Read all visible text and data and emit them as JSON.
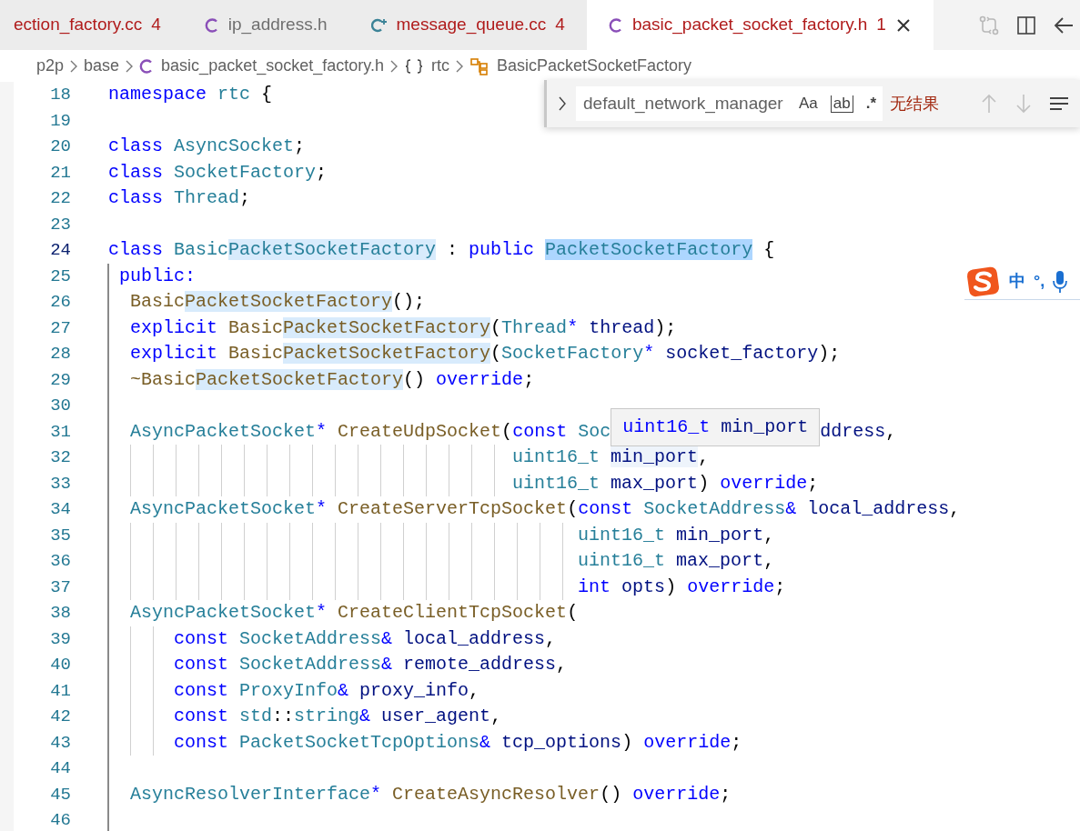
{
  "tabs": [
    {
      "label": "ection_factory.cc",
      "problems": "4",
      "kind": "plain",
      "color": "#b01b1b",
      "selected": false
    },
    {
      "label": "ip_address.h",
      "kind": "c",
      "color": "#6f6f6f",
      "selected": false
    },
    {
      "label": "message_queue.cc",
      "problems": "4",
      "kind": "cpp",
      "color": "#b01b1b",
      "selected": false
    },
    {
      "label": "basic_packet_socket_factory.h",
      "problems": "1",
      "kind": "c",
      "color": "#b01b1b",
      "selected": true
    }
  ],
  "breadcrumbs": [
    {
      "text": "p2p",
      "kind": "folder"
    },
    {
      "text": "base",
      "kind": "folder"
    },
    {
      "text": "basic_packet_socket_factory.h",
      "kind": "c"
    },
    {
      "text": "rtc",
      "kind": "namespace"
    },
    {
      "text": "BasicPacketSocketFactory",
      "kind": "class"
    }
  ],
  "find": {
    "expanded": false,
    "value": "default_network_manager",
    "toggles": [
      {
        "label": "Aa",
        "kind": "case",
        "selected": false
      },
      {
        "label": "ab",
        "kind": "word",
        "selected": false
      },
      {
        "label": ".*",
        "kind": "regex",
        "selected": false
      }
    ],
    "result": "无结果"
  },
  "ime": {
    "mode": "中",
    "punctuation": "°,"
  },
  "lines": [
    {
      "number": "18",
      "current": false,
      "in_block": false,
      "tokens": [
        {
          "text": "namespace",
          "kind": "keyword"
        },
        {
          "text": " rtc",
          "kind": "type"
        },
        {
          "text": " {",
          "kind": "punct"
        }
      ]
    },
    {
      "number": "19",
      "current": false,
      "in_block": false
    },
    {
      "number": "20",
      "current": false,
      "in_block": false,
      "tokens": [
        {
          "text": "class",
          "kind": "keyword"
        },
        {
          "text": " AsyncSocket",
          "kind": "type"
        },
        {
          "text": ";",
          "kind": "punct"
        }
      ]
    },
    {
      "number": "21",
      "current": false,
      "in_block": false,
      "tokens": [
        {
          "text": "class",
          "kind": "keyword"
        },
        {
          "text": " SocketFactory",
          "kind": "type"
        },
        {
          "text": ";",
          "kind": "punct"
        }
      ]
    },
    {
      "number": "22",
      "current": false,
      "in_block": false,
      "tokens": [
        {
          "text": "class",
          "kind": "keyword"
        },
        {
          "text": " Thread",
          "kind": "type"
        },
        {
          "text": ";",
          "kind": "punct"
        }
      ]
    },
    {
      "number": "23",
      "current": false,
      "in_block": false
    },
    {
      "number": "24",
      "current": true,
      "in_block": false,
      "tokens": [
        {
          "text": "class",
          "kind": "keyword"
        },
        {
          "text": " Basic",
          "kind": "type"
        },
        {
          "text": "PacketSocketFactory",
          "kind": "type_match"
        },
        {
          "text": " : ",
          "kind": "punct"
        },
        {
          "text": "public ",
          "kind": "keyword"
        },
        {
          "text": "PacketSocketFactory",
          "kind": "type_selected"
        },
        {
          "text": " {",
          "kind": "punct"
        }
      ]
    },
    {
      "number": "25",
      "current": false,
      "in_block": true,
      "tokens": [
        {
          "text": " public:",
          "kind": "keyword"
        }
      ]
    },
    {
      "number": "26",
      "current": false,
      "in_block": true,
      "tokens": [
        {
          "text": "  Basic",
          "kind": "func"
        },
        {
          "text": "PacketSocketFactory",
          "kind": "func_match"
        },
        {
          "text": "();",
          "kind": "punct"
        }
      ]
    },
    {
      "number": "27",
      "current": false,
      "in_block": true,
      "tokens": [
        {
          "text": "  explicit",
          "kind": "keyword"
        },
        {
          "text": " Basic",
          "kind": "func"
        },
        {
          "text": "PacketSocketFactory",
          "kind": "func_match"
        },
        {
          "text": "(",
          "kind": "punct"
        },
        {
          "text": "Thread",
          "kind": "type"
        },
        {
          "text": "*",
          "kind": "keyword"
        },
        {
          "text": " thread",
          "kind": "param"
        },
        {
          "text": ");",
          "kind": "punct"
        }
      ]
    },
    {
      "number": "28",
      "current": false,
      "in_block": true,
      "tokens": [
        {
          "text": "  explicit",
          "kind": "keyword"
        },
        {
          "text": " Basic",
          "kind": "func"
        },
        {
          "text": "PacketSocketFactory",
          "kind": "func_match"
        },
        {
          "text": "(",
          "kind": "punct"
        },
        {
          "text": "SocketFactory",
          "kind": "type"
        },
        {
          "text": "*",
          "kind": "keyword"
        },
        {
          "text": " socket_factory",
          "kind": "param"
        },
        {
          "text": ");",
          "kind": "punct"
        }
      ]
    },
    {
      "number": "29",
      "current": false,
      "in_block": true,
      "tokens": [
        {
          "text": "  ~Basic",
          "kind": "func"
        },
        {
          "text": "PacketSocketFactory",
          "kind": "func_match"
        },
        {
          "text": "()",
          "kind": "punct"
        },
        {
          "text": " override",
          "kind": "keyword"
        },
        {
          "text": ";",
          "kind": "punct"
        }
      ]
    },
    {
      "number": "30",
      "current": false,
      "in_block": true
    },
    {
      "number": "31",
      "current": false,
      "in_block": true,
      "tokens": [
        {
          "text": "  AsyncPacketSocket",
          "kind": "type"
        },
        {
          "text": "*",
          "kind": "keyword"
        },
        {
          "text": " CreateUdpSocket",
          "kind": "func"
        },
        {
          "text": "(",
          "kind": "punct"
        },
        {
          "text": "const",
          "kind": "keyword"
        },
        {
          "text": " Soc",
          "kind": "type"
        },
        {
          "kind": "tooltip",
          "parts": [
            {
              "text": "uint16_t",
              "kind": "keyword"
            },
            {
              "text": " min_port",
              "kind": "param"
            }
          ]
        },
        {
          "text": "ddress",
          "kind": "param"
        },
        {
          "text": ",",
          "kind": "punct"
        }
      ]
    },
    {
      "number": "32",
      "current": false,
      "in_block": true,
      "tokens": [
        {
          "text": "                                     uint16_t ",
          "kind": "type"
        },
        {
          "text": "min_port",
          "kind": "param_hover"
        },
        {
          "text": ",",
          "kind": "punct"
        }
      ]
    },
    {
      "number": "33",
      "current": false,
      "in_block": true,
      "tokens": [
        {
          "text": "                                     uint16_t",
          "kind": "type"
        },
        {
          "text": " max_port",
          "kind": "param"
        },
        {
          "text": ")",
          "kind": "punct"
        },
        {
          "text": " override",
          "kind": "keyword"
        },
        {
          "text": ";",
          "kind": "punct"
        }
      ]
    },
    {
      "number": "34",
      "current": false,
      "in_block": true,
      "tokens": [
        {
          "text": "  AsyncPacketSocket",
          "kind": "type"
        },
        {
          "text": "*",
          "kind": "keyword"
        },
        {
          "text": " CreateServerTcpSocket",
          "kind": "func"
        },
        {
          "text": "(",
          "kind": "punct"
        },
        {
          "text": "const",
          "kind": "keyword"
        },
        {
          "text": " SocketAddress",
          "kind": "type"
        },
        {
          "text": "&",
          "kind": "keyword"
        },
        {
          "text": " local_address",
          "kind": "param"
        },
        {
          "text": ",",
          "kind": "punct"
        }
      ]
    },
    {
      "number": "35",
      "current": false,
      "in_block": true,
      "tokens": [
        {
          "text": "                                           uint16_t",
          "kind": "type"
        },
        {
          "text": " min_port",
          "kind": "param"
        },
        {
          "text": ",",
          "kind": "punct"
        }
      ]
    },
    {
      "number": "36",
      "current": false,
      "in_block": true,
      "tokens": [
        {
          "text": "                                           uint16_t",
          "kind": "type"
        },
        {
          "text": " max_port",
          "kind": "param"
        },
        {
          "text": ",",
          "kind": "punct"
        }
      ]
    },
    {
      "number": "37",
      "current": false,
      "in_block": true,
      "tokens": [
        {
          "text": "                                           int",
          "kind": "keyword"
        },
        {
          "text": " opts",
          "kind": "param"
        },
        {
          "text": ")",
          "kind": "punct"
        },
        {
          "text": " override",
          "kind": "keyword"
        },
        {
          "text": ";",
          "kind": "punct"
        }
      ]
    },
    {
      "number": "38",
      "current": false,
      "in_block": true,
      "tokens": [
        {
          "text": "  AsyncPacketSocket",
          "kind": "type"
        },
        {
          "text": "*",
          "kind": "keyword"
        },
        {
          "text": " CreateClientTcpSocket",
          "kind": "func"
        },
        {
          "text": "(",
          "kind": "punct"
        }
      ]
    },
    {
      "number": "39",
      "current": false,
      "in_block": true,
      "tokens": [
        {
          "text": "      const",
          "kind": "keyword"
        },
        {
          "text": " SocketAddress",
          "kind": "type"
        },
        {
          "text": "&",
          "kind": "keyword"
        },
        {
          "text": " local_address",
          "kind": "param"
        },
        {
          "text": ",",
          "kind": "punct"
        }
      ]
    },
    {
      "number": "40",
      "current": false,
      "in_block": true,
      "tokens": [
        {
          "text": "      const",
          "kind": "keyword"
        },
        {
          "text": " SocketAddress",
          "kind": "type"
        },
        {
          "text": "&",
          "kind": "keyword"
        },
        {
          "text": " remote_address",
          "kind": "param"
        },
        {
          "text": ",",
          "kind": "punct"
        }
      ]
    },
    {
      "number": "41",
      "current": false,
      "in_block": true,
      "tokens": [
        {
          "text": "      const",
          "kind": "keyword"
        },
        {
          "text": " ProxyInfo",
          "kind": "type"
        },
        {
          "text": "&",
          "kind": "keyword"
        },
        {
          "text": " proxy_info",
          "kind": "param"
        },
        {
          "text": ",",
          "kind": "punct"
        }
      ]
    },
    {
      "number": "42",
      "current": false,
      "in_block": true,
      "tokens": [
        {
          "text": "      const",
          "kind": "keyword"
        },
        {
          "text": " std",
          "kind": "type"
        },
        {
          "text": "::",
          "kind": "punct"
        },
        {
          "text": "string",
          "kind": "type"
        },
        {
          "text": "&",
          "kind": "keyword"
        },
        {
          "text": " user_agent",
          "kind": "param"
        },
        {
          "text": ",",
          "kind": "punct"
        }
      ]
    },
    {
      "number": "43",
      "current": false,
      "in_block": true,
      "tokens": [
        {
          "text": "      const",
          "kind": "keyword"
        },
        {
          "text": " PacketSocketTcpOptions",
          "kind": "type"
        },
        {
          "text": "&",
          "kind": "keyword"
        },
        {
          "text": " tcp_options",
          "kind": "param"
        },
        {
          "text": ")",
          "kind": "punct"
        },
        {
          "text": " override",
          "kind": "keyword"
        },
        {
          "text": ";",
          "kind": "punct"
        }
      ]
    },
    {
      "number": "44",
      "current": false,
      "in_block": true
    },
    {
      "number": "45",
      "current": false,
      "in_block": true,
      "tokens": [
        {
          "text": "  AsyncResolverInterface",
          "kind": "type"
        },
        {
          "text": "*",
          "kind": "keyword"
        },
        {
          "text": " CreateAsyncResolver",
          "kind": "func"
        },
        {
          "text": "()",
          "kind": "punct"
        },
        {
          "text": " override",
          "kind": "keyword"
        },
        {
          "text": ";",
          "kind": "punct"
        }
      ]
    },
    {
      "number": "46",
      "current": false,
      "in_block": true
    }
  ]
}
